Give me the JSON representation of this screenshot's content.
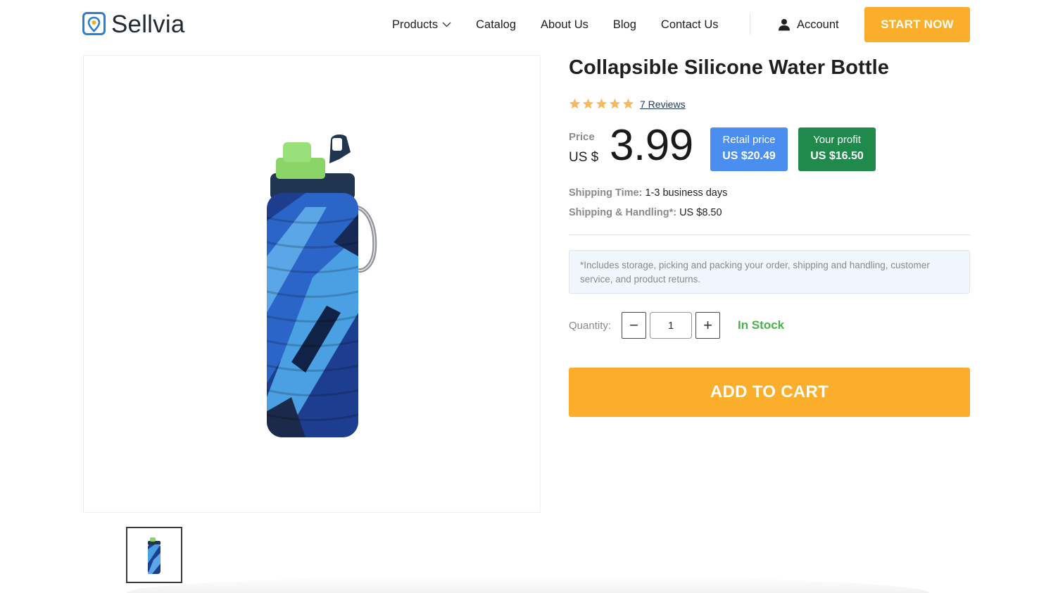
{
  "header": {
    "logo_text": "Sellvia",
    "nav": {
      "products": "Products",
      "catalog": "Catalog",
      "about": "About Us",
      "blog": "Blog",
      "contact": "Contact Us"
    },
    "account_label": "Account",
    "start_button": "START NOW"
  },
  "product": {
    "title": "Collapsible Silicone Water Bottle",
    "rating": 5,
    "reviews_label": "7 Reviews",
    "price_label": "Price",
    "currency": "US $",
    "price": "3.99",
    "retail_label": "Retail price",
    "retail_value": "US $20.49",
    "profit_label": "Your profit",
    "profit_value": "US $16.50",
    "shipping_time_label": "Shipping Time:",
    "shipping_time_value": "1-3 business days",
    "shipping_handling_label": "Shipping & Handling*:",
    "shipping_handling_value": "US $8.50",
    "note": "*Includes storage, picking and packing your order, shipping and handling, customer service, and product returns.",
    "quantity_label": "Quantity:",
    "quantity_value": "1",
    "minus_symbol": "−",
    "plus_symbol": "+",
    "stock_status": "In Stock",
    "add_to_cart": "ADD TO CART"
  },
  "colors": {
    "accent_orange": "#fbae2b",
    "retail_blue": "#4a8ef0",
    "profit_green": "#1f8a4c",
    "stock_green": "#4caf50",
    "star": "#f7b860"
  },
  "icons": {
    "logo": "location-pin-logo-icon",
    "products_chevron": "chevron-down-icon",
    "account": "user-icon",
    "star": "star-icon"
  }
}
